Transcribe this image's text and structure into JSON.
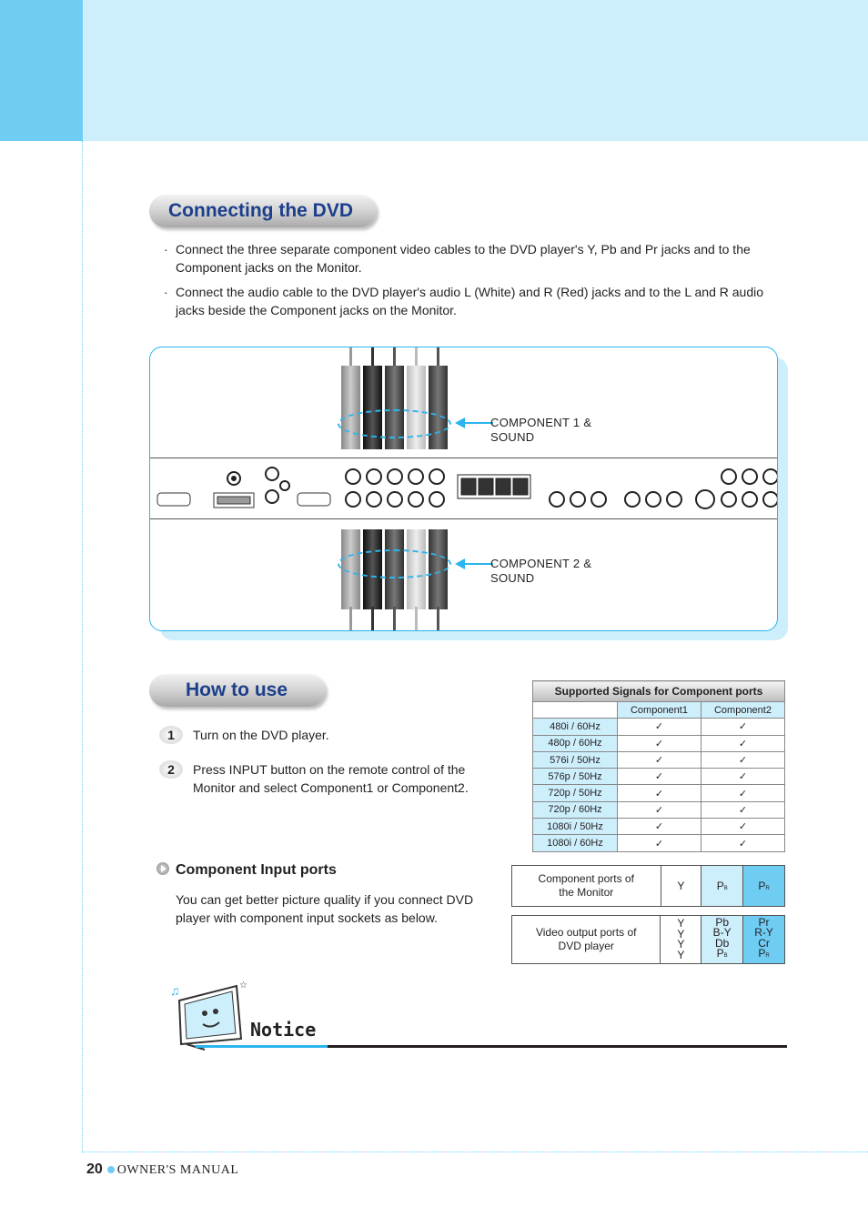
{
  "sections": {
    "connecting": {
      "title": "Connecting the DVD"
    },
    "how_to_use": {
      "title": "How to use"
    }
  },
  "bullets": [
    "Connect the three separate component video cables to the DVD player's Y, Pb and Pr jacks and to the Component jacks on the Monitor.",
    "Connect the audio cable to the DVD player's audio L (White) and R (Red) jacks and to the L and R audio jacks beside the Component jacks on the Monitor."
  ],
  "bullet_glyph": "·",
  "diagram": {
    "label_top_line1": "COMPONENT 1 &",
    "label_top_line2": "SOUND",
    "label_bottom_line1": "COMPONENT 2 &",
    "label_bottom_line2": "SOUND",
    "accent_color": "#2bb5ee"
  },
  "steps": [
    {
      "num": "1",
      "text": "Turn on the DVD player."
    },
    {
      "num": "2",
      "text": "Press INPUT button on the remote control of the Monitor and select Component1 or Component2."
    }
  ],
  "signals_table": {
    "title": "Supported Signals for Component ports",
    "columns": [
      "",
      "Component1",
      "Component2"
    ],
    "check": "✓",
    "rows": [
      {
        "label": "480i / 60Hz",
        "c1": "✓",
        "c2": "✓"
      },
      {
        "label": "480p / 60Hz",
        "c1": "✓",
        "c2": "✓"
      },
      {
        "label": "576i / 50Hz",
        "c1": "✓",
        "c2": "✓"
      },
      {
        "label": "576p / 50Hz",
        "c1": "✓",
        "c2": "✓"
      },
      {
        "label": "720p / 50Hz",
        "c1": "✓",
        "c2": "✓"
      },
      {
        "label": "720p / 60Hz",
        "c1": "✓",
        "c2": "✓"
      },
      {
        "label": "1080i / 50Hz",
        "c1": "✓",
        "c2": "✓"
      },
      {
        "label": "1080i / 60Hz",
        "c1": "✓",
        "c2": "✓"
      }
    ]
  },
  "component_input": {
    "title": "Component Input ports",
    "text": "You can get better picture quality if you connect DVD player with component input sockets as below."
  },
  "ports_table": {
    "monitor_label_1": "Component ports of",
    "monitor_label_2": "the Monitor",
    "monitor_y": "Y",
    "monitor_pb_main": "P",
    "monitor_pb_sub": "B",
    "monitor_pr_main": "P",
    "monitor_pr_sub": "R",
    "dvd_label_1": "Video output ports of",
    "dvd_label_2": "DVD player",
    "dvd_y": [
      "Y",
      "Y",
      "Y",
      "Y"
    ],
    "dvd_pb": [
      "Pb",
      "B-Y",
      "Db"
    ],
    "dvd_pb_last_main": "P",
    "dvd_pb_last_sub": "B",
    "dvd_pr": [
      "Pr",
      "R-Y",
      "Cr"
    ],
    "dvd_pr_last_main": "P",
    "dvd_pr_last_sub": "R"
  },
  "notice": {
    "title": "Notice"
  },
  "footer": {
    "page_number": "20",
    "label": "OWNER'S MANUAL"
  }
}
